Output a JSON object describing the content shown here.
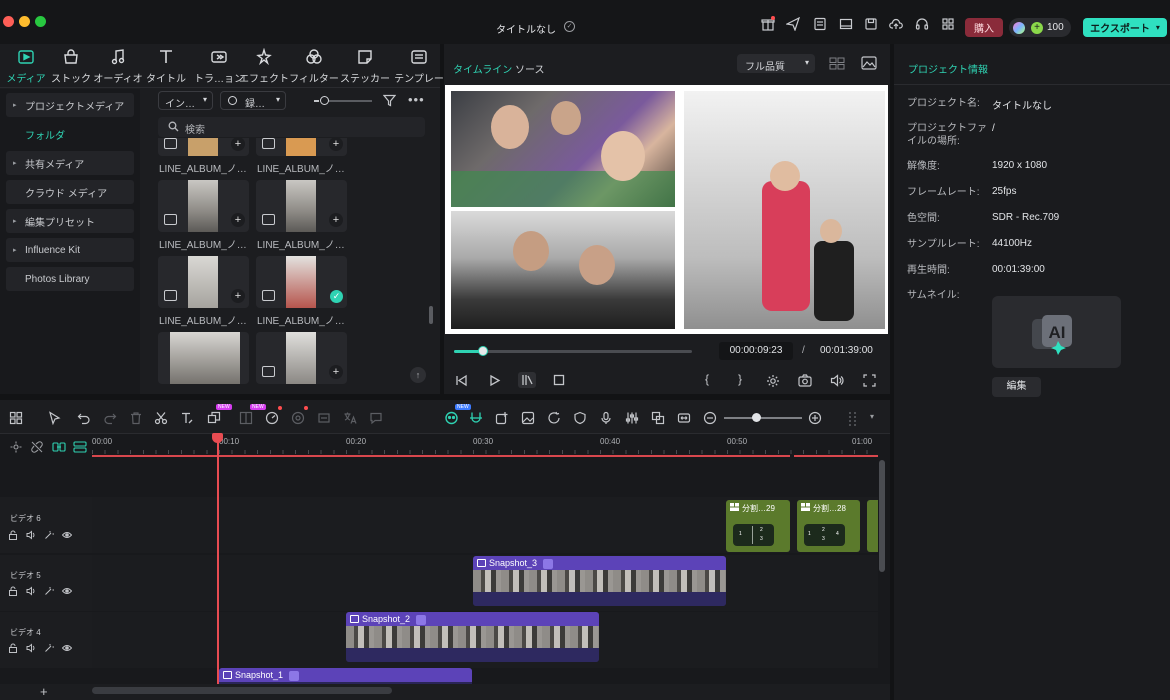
{
  "window": {
    "title": "タイトルなし"
  },
  "topbar": {
    "buy_label": "購入",
    "credits": "100",
    "export_label": "エクスポート"
  },
  "toolbar": {
    "tabs": [
      {
        "label": "メディア",
        "icon": "media-icon"
      },
      {
        "label": "ストック",
        "icon": "stock-icon"
      },
      {
        "label": "オーディオ",
        "icon": "audio-icon"
      },
      {
        "label": "タイトル",
        "icon": "title-icon"
      },
      {
        "label": "トラ…ョン",
        "icon": "transition-icon"
      },
      {
        "label": "エフェクト",
        "icon": "effect-icon"
      },
      {
        "label": "フィルター",
        "icon": "filter-icon"
      },
      {
        "label": "ステッカー",
        "icon": "sticker-icon"
      },
      {
        "label": "テンプレー",
        "icon": "template-icon"
      }
    ]
  },
  "sidebar": {
    "items": [
      {
        "label": "プロジェクトメディア",
        "expandable": true
      },
      {
        "label": "フォルダ",
        "expandable": false,
        "selected": true
      },
      {
        "label": "共有メディア",
        "expandable": true
      },
      {
        "label": "クラウド メディア",
        "expandable": false
      },
      {
        "label": "編集プリセット",
        "expandable": true
      },
      {
        "label": "Influence Kit",
        "expandable": true
      },
      {
        "label": "Photos Library",
        "expandable": false
      }
    ]
  },
  "media": {
    "import_dropdown": "イン…",
    "record_dropdown": "録…",
    "search_placeholder": "検索",
    "items": [
      {
        "label": "LINE_ALBUM_ノ…"
      },
      {
        "label": "LINE_ALBUM_ノ…"
      },
      {
        "label": "LINE_ALBUM_ノ…"
      },
      {
        "label": "LINE_ALBUM_ノ…"
      },
      {
        "label": "LINE_ALBUM_ノ…"
      },
      {
        "label": "LINE_ALBUM_ノ…"
      }
    ]
  },
  "preview": {
    "tabs": [
      "タイムライン",
      "ソース"
    ],
    "quality": "フル品質",
    "current_time": "00:00:09:23",
    "separator": "/",
    "total_time": "00:01:39:00",
    "progress": 0.12
  },
  "project_info": {
    "title": "プロジェクト情報",
    "rows": [
      {
        "label": "プロジェクト名:",
        "value": "タイトルなし"
      },
      {
        "label": "プロジェクトファイルの場所:",
        "value": "/"
      },
      {
        "label": "解像度:",
        "value": "1920 x 1080"
      },
      {
        "label": "フレームレート:",
        "value": "25fps"
      },
      {
        "label": "色空間:",
        "value": "SDR - Rec.709"
      },
      {
        "label": "サンプルレート:",
        "value": "44100Hz"
      },
      {
        "label": "再生時間:",
        "value": "00:01:39:00"
      },
      {
        "label": "サムネイル:",
        "value": ""
      }
    ],
    "edit_label": "編集"
  },
  "timeline": {
    "ruler": [
      "00:00",
      "00:10",
      "00:20",
      "00:30",
      "00:40",
      "00:50",
      "01:00"
    ],
    "tracks": [
      "ビデオ 6",
      "ビデオ 5",
      "ビデオ 4"
    ],
    "clips": [
      {
        "label": "Snapshot_3"
      },
      {
        "label": "Snapshot_2"
      },
      {
        "label": "Snapshot_1"
      }
    ],
    "split_clips": [
      {
        "label": "分割…29"
      },
      {
        "label": "分割…28"
      }
    ]
  },
  "colors": {
    "accent": "#2fd3b3",
    "clip": "#5c43b8",
    "playhead": "#e84c52",
    "split": "#5b7a2c"
  }
}
